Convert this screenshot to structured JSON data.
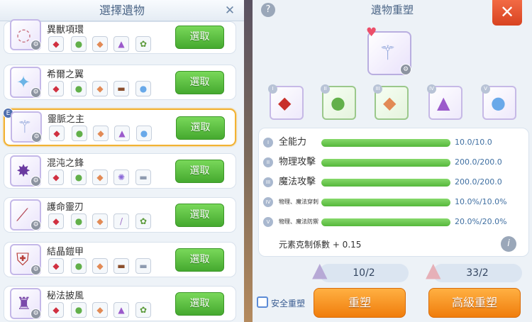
{
  "left_panel": {
    "title": "選擇遺物",
    "close_icon": "close-icon",
    "select_label": "選取",
    "items": [
      {
        "name": "異獸項環",
        "icon": "necklace",
        "selected": false,
        "mats": [
          "red-crystal",
          "green-gem",
          "orange-ore",
          "purple-flask",
          "herb"
        ]
      },
      {
        "name": "希爾之翼",
        "icon": "wing",
        "selected": false,
        "mats": [
          "red-crystal",
          "green-gem",
          "orange-ore",
          "gun",
          "blue-orb"
        ]
      },
      {
        "name": "靈脈之主",
        "icon": "staff",
        "selected": true,
        "badge": "E",
        "mats": [
          "red-crystal",
          "green-gem",
          "orange-ore",
          "purple-flask",
          "blue-orb"
        ]
      },
      {
        "name": "混沌之鋒",
        "icon": "chaos-blade",
        "selected": false,
        "mats": [
          "red-crystal",
          "green-gem",
          "orange-ore",
          "purple-star",
          "metal-bar"
        ]
      },
      {
        "name": "護命靈刃",
        "icon": "spirit-blade",
        "selected": false,
        "mats": [
          "red-crystal",
          "green-gem",
          "orange-ore",
          "wand",
          "herb"
        ]
      },
      {
        "name": "結晶鎧甲",
        "icon": "armor",
        "selected": false,
        "mats": [
          "red-crystal",
          "green-gem",
          "orange-ore",
          "gun",
          "metal-bar"
        ]
      },
      {
        "name": "秘法披風",
        "icon": "cloak",
        "selected": false,
        "mats": [
          "red-crystal",
          "green-gem",
          "orange-ore",
          "purple-flask",
          "herb"
        ]
      }
    ]
  },
  "right_panel": {
    "title": "遺物重塑",
    "help_icon": "help-icon",
    "close_icon": "close-icon",
    "main_item_icon": "staff",
    "heart_icon": "heart-icon",
    "slots": [
      {
        "roman": "I",
        "icon": "red-crystal"
      },
      {
        "roman": "II",
        "icon": "green-gem"
      },
      {
        "roman": "III",
        "icon": "orange-ore"
      },
      {
        "roman": "IV",
        "icon": "purple-flask"
      },
      {
        "roman": "V",
        "icon": "blue-orb"
      }
    ],
    "stats": [
      {
        "badge": "I",
        "label": "全能力",
        "value": "10.0/10.0",
        "fill": 1.0
      },
      {
        "badge": "II",
        "label": "物理攻擊",
        "value": "200.0/200.0",
        "fill": 1.0
      },
      {
        "badge": "III",
        "label": "魔法攻擊",
        "value": "200.0/200.0",
        "fill": 1.0
      },
      {
        "badge": "IV",
        "label": "物理、魔法穿刺",
        "value": "10.0%/10.0%",
        "fill": 1.0
      },
      {
        "badge": "V",
        "label": "物理、魔法防禦",
        "value": "20.0%/20.0%",
        "fill": 1.0
      }
    ],
    "coefficient": "元素克制係數 + 0.15",
    "info_icon": "info-icon",
    "costs": [
      {
        "value": "10/2",
        "icon": "powder-pile"
      },
      {
        "value": "33/2",
        "icon": "pink-powder-pile"
      }
    ],
    "safe_label": "安全重塑",
    "reforge_label": "重塑",
    "advanced_reforge_label": "高級重塑"
  },
  "colors": {
    "select_button": "#4fb237",
    "selected_border": "#f2b233",
    "orange_button": "#f58a15",
    "close_red": "#e0502b",
    "stat_bar": "#62c046"
  }
}
